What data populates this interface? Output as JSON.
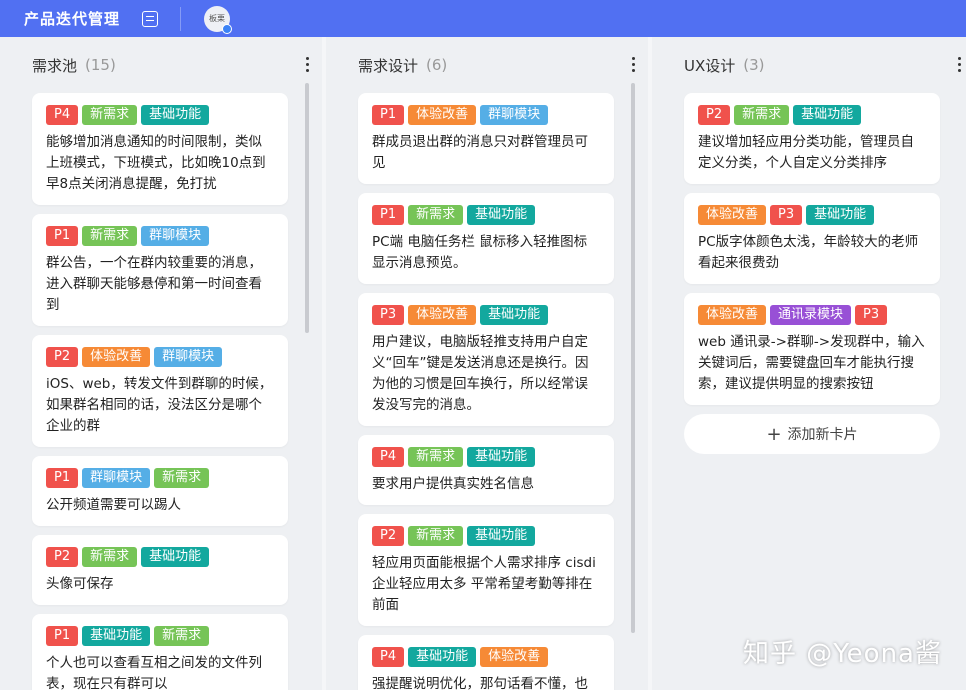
{
  "header": {
    "title": "产品迭代管理",
    "avatar_text": "板栗"
  },
  "tag_colors": {
    "P1": "#f0524c",
    "P2": "#f0524c",
    "P3": "#f0524c",
    "P4": "#f0524c",
    "新需求": "#76c457",
    "基础功能": "#13a89e",
    "群聊模块": "#55aee6",
    "体验改善": "#f68a36",
    "通讯录模块": "#9850d6"
  },
  "columns": [
    {
      "title": "需求池",
      "count": "(15)",
      "cards": [
        {
          "tags": [
            "P4",
            "新需求",
            "基础功能"
          ],
          "text": "能够增加消息通知的时间限制，类似上班模式，下班模式，比如晚10点到早8点关闭消息提醒，免打扰"
        },
        {
          "tags": [
            "P1",
            "新需求",
            "群聊模块"
          ],
          "text": "群公告，一个在群内较重要的消息，进入群聊天能够悬停和第一时间查看到"
        },
        {
          "tags": [
            "P2",
            "体验改善",
            "群聊模块"
          ],
          "text": "iOS、web，转发文件到群聊的时候，如果群名相同的话，没法区分是哪个企业的群"
        },
        {
          "tags": [
            "P1",
            "群聊模块",
            "新需求"
          ],
          "text": "公开频道需要可以踢人"
        },
        {
          "tags": [
            "P2",
            "新需求",
            "基础功能"
          ],
          "text": "头像可保存"
        },
        {
          "tags": [
            "P1",
            "基础功能",
            "新需求"
          ],
          "text": "个人也可以查看互相之间发的文件列表，现在只有群可以"
        }
      ]
    },
    {
      "title": "需求设计",
      "count": "(6)",
      "cards": [
        {
          "tags": [
            "P1",
            "体验改善",
            "群聊模块"
          ],
          "text": "群成员退出群的消息只对群管理员可见"
        },
        {
          "tags": [
            "P1",
            "新需求",
            "基础功能"
          ],
          "text": "PC端 电脑任务栏 鼠标移入轻推图标显示消息预览。"
        },
        {
          "tags": [
            "P3",
            "体验改善",
            "基础功能"
          ],
          "text": "用户建议，电脑版轻推支持用户自定义“回车”键是发送消息还是换行。因为他的习惯是回车换行，所以经常误发没写完的消息。"
        },
        {
          "tags": [
            "P4",
            "新需求",
            "基础功能"
          ],
          "text": "要求用户提供真实姓名信息"
        },
        {
          "tags": [
            "P2",
            "新需求",
            "基础功能"
          ],
          "text": "轻应用页面能根据个人需求排序 cisdi企业轻应用太多 平常希望考勤等排在前面"
        },
        {
          "tags": [
            "P4",
            "基础功能",
            "体验改善"
          ],
          "text": "强提醒说明优化，那句话看不懂，也"
        }
      ]
    },
    {
      "title": "UX设计",
      "count": "(3)",
      "cards": [
        {
          "tags": [
            "P2",
            "新需求",
            "基础功能"
          ],
          "text": "建议增加轻应用分类功能，管理员自定义分类，个人自定义分类排序"
        },
        {
          "tags": [
            "体验改善",
            "P3",
            "基础功能"
          ],
          "text": "PC版字体颜色太浅，年龄较大的老师看起来很费劲"
        },
        {
          "tags": [
            "体验改善",
            "通讯录模块",
            "P3"
          ],
          "text": "web 通讯录->群聊->发现群中，输入关键词后，需要键盘回车才能执行搜索，建议提供明显的搜索按钮"
        }
      ],
      "add_label": "添加新卡片"
    }
  ],
  "watermark": "知乎 @Yeona酱"
}
